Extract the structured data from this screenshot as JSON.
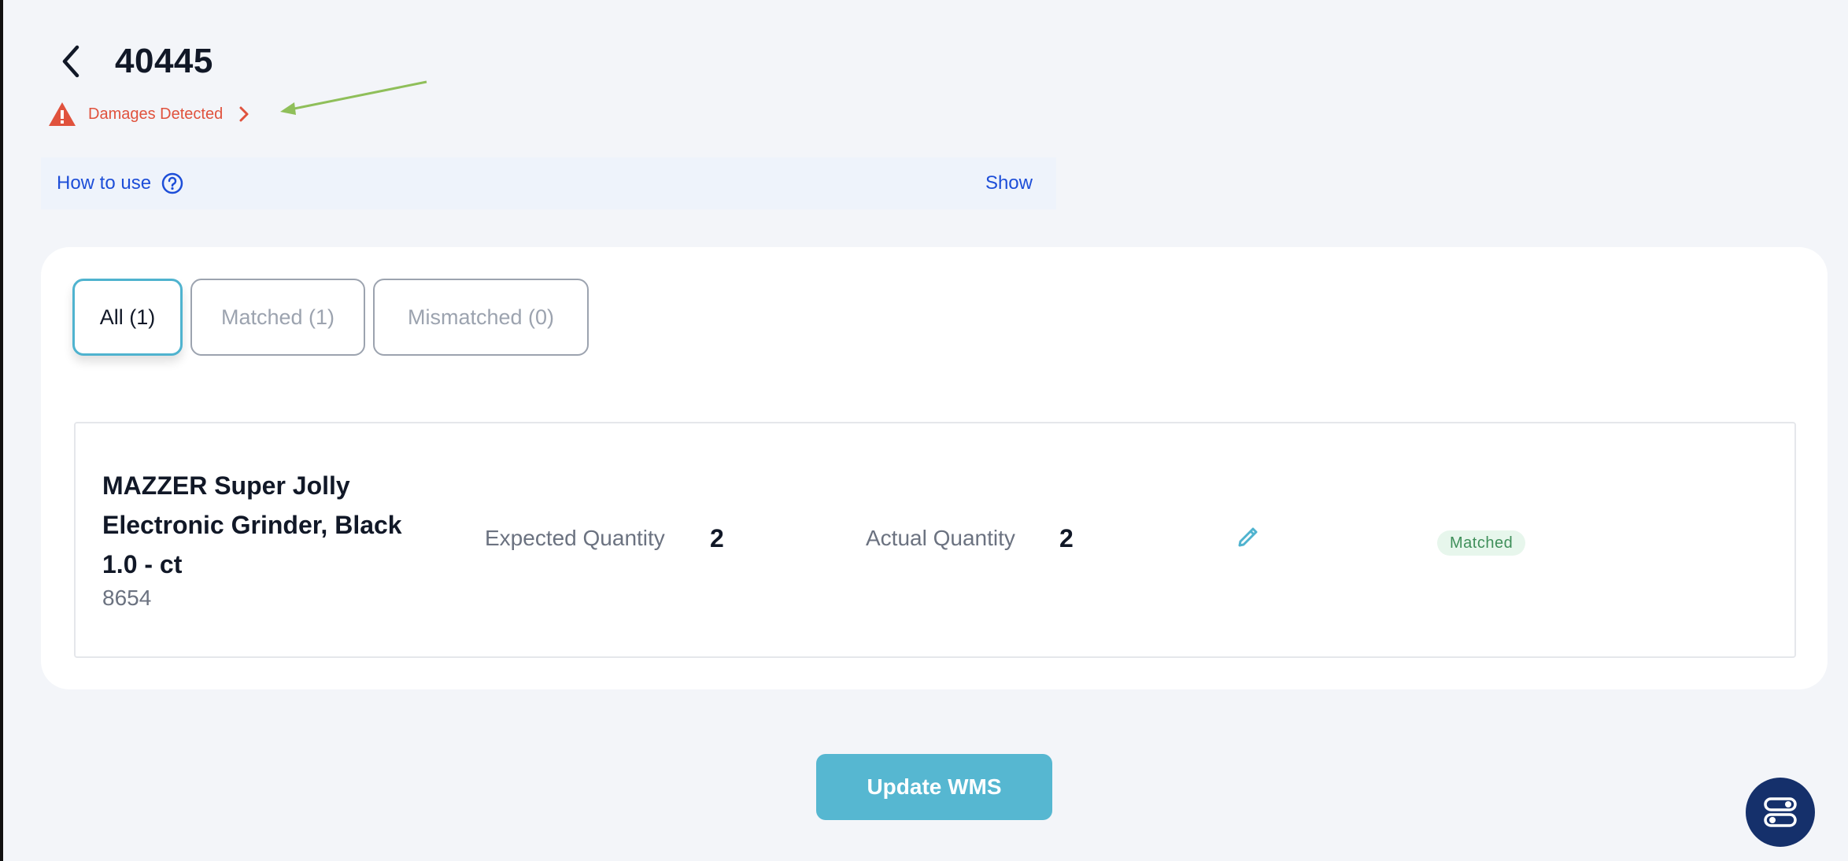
{
  "header": {
    "title": "40445"
  },
  "alert": {
    "label": "Damages Detected"
  },
  "help_bar": {
    "label": "How to use",
    "toggle_label": "Show"
  },
  "tabs": [
    {
      "label": "All (1)",
      "active": true
    },
    {
      "label": "Matched (1)",
      "active": false
    },
    {
      "label": "Mismatched (0)",
      "active": false
    }
  ],
  "items": [
    {
      "name": "MAZZER Super Jolly Electronic Grinder, Black 1.0 - ct",
      "sku": "8654",
      "expected_label": "Expected Quantity",
      "expected_value": "2",
      "actual_label": "Actual Quantity",
      "actual_value": "2",
      "status": "Matched"
    }
  ],
  "footer": {
    "update_button": "Update WMS"
  },
  "colors": {
    "accent": "#56b7d1",
    "link": "#1d4ed8",
    "alert": "#e0523d",
    "matched_bg": "#e7f6ec",
    "matched_text": "#3f8f5a",
    "fab": "#15306b"
  },
  "icons": {
    "back": "chevron-left-icon",
    "alert": "warning-triangle-icon",
    "alert_chevron": "chevron-right-icon",
    "help": "question-circle-icon",
    "edit": "pencil-icon",
    "fab": "toggle-settings-icon"
  }
}
